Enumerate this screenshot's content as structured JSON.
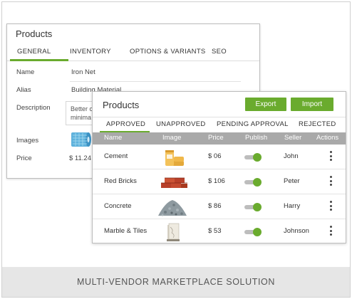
{
  "footer": {
    "caption": "MULTI-VENDOR MARKETPLACE SOLUTION"
  },
  "back_panel": {
    "title": "Products",
    "tabs": [
      "GENERAL",
      "INVENTORY",
      "OPTIONS & VARIANTS",
      "SEO"
    ],
    "active_tab": "GENERAL",
    "fields": {
      "name_label": "Name",
      "name_value": "Iron Net",
      "alias_label": "Alias",
      "alias_value": "Building Material",
      "description_label": "Description",
      "description_line1": "Better c",
      "description_line2": "minima",
      "images_label": "Images",
      "images_icon": "iron-net-roll",
      "price_label": "Price",
      "price_value": "$ 11.24"
    }
  },
  "front_panel": {
    "title": "Products",
    "export_label": "Export",
    "import_label": "Import",
    "tabs": [
      "APPROVED",
      "UNAPPROVED",
      "PENDING APPROVAL",
      "REJECTED"
    ],
    "active_tab": "APPROVED",
    "columns": [
      "Name",
      "Image",
      "Price",
      "Publish",
      "Seller",
      "Actions"
    ],
    "rows": [
      {
        "name": "Cement",
        "image_icon": "cement-bags",
        "price": "$ 06",
        "publish": true,
        "seller": "John"
      },
      {
        "name": "Red Bricks",
        "image_icon": "red-bricks",
        "price": "$ 106",
        "publish": true,
        "seller": "Peter"
      },
      {
        "name": "Concrete",
        "image_icon": "concrete-pile",
        "price": "$ 86",
        "publish": true,
        "seller": "Harry"
      },
      {
        "name": "Marble & Tiles",
        "image_icon": "marble-tiles",
        "price": "$ 53",
        "publish": true,
        "seller": "Johnson"
      }
    ]
  },
  "colors": {
    "accent": "#6aab2e",
    "header_bg": "#a9a9a9",
    "footer_bg": "#e6e6e6"
  }
}
